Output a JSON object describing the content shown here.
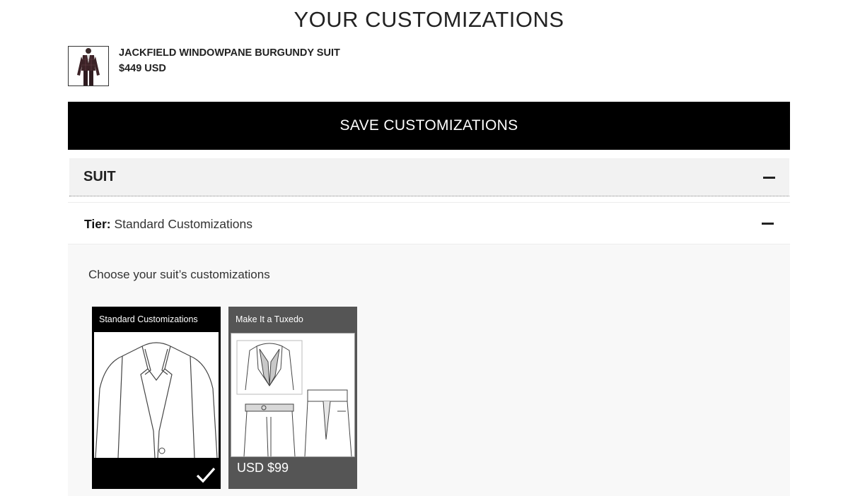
{
  "page": {
    "title": "YOUR CUSTOMIZATIONS"
  },
  "product": {
    "name": "JACKFIELD WINDOWPANE BURGUNDY SUIT",
    "price": "$449 USD",
    "thumbnail_icon": "suit-photo"
  },
  "actions": {
    "save_label": "SAVE CUSTOMIZATIONS"
  },
  "suit_section": {
    "title": "SUIT",
    "expanded": true
  },
  "tier": {
    "label": "Tier:",
    "value": "Standard Customizations",
    "expanded": true
  },
  "customizations": {
    "prompt": "Choose your suit’s customizations",
    "options": [
      {
        "label": "Standard Customizations",
        "price": "",
        "selected": true,
        "icon": "jacket-sketch"
      },
      {
        "label": "Make It a Tuxedo",
        "price": "USD $99",
        "selected": false,
        "icon": "tuxedo-sketch"
      }
    ]
  },
  "colors": {
    "primary": "#000000",
    "selected_card": "#000000",
    "unselected_card": "#555555",
    "section_bg": "#f2f2f2"
  }
}
